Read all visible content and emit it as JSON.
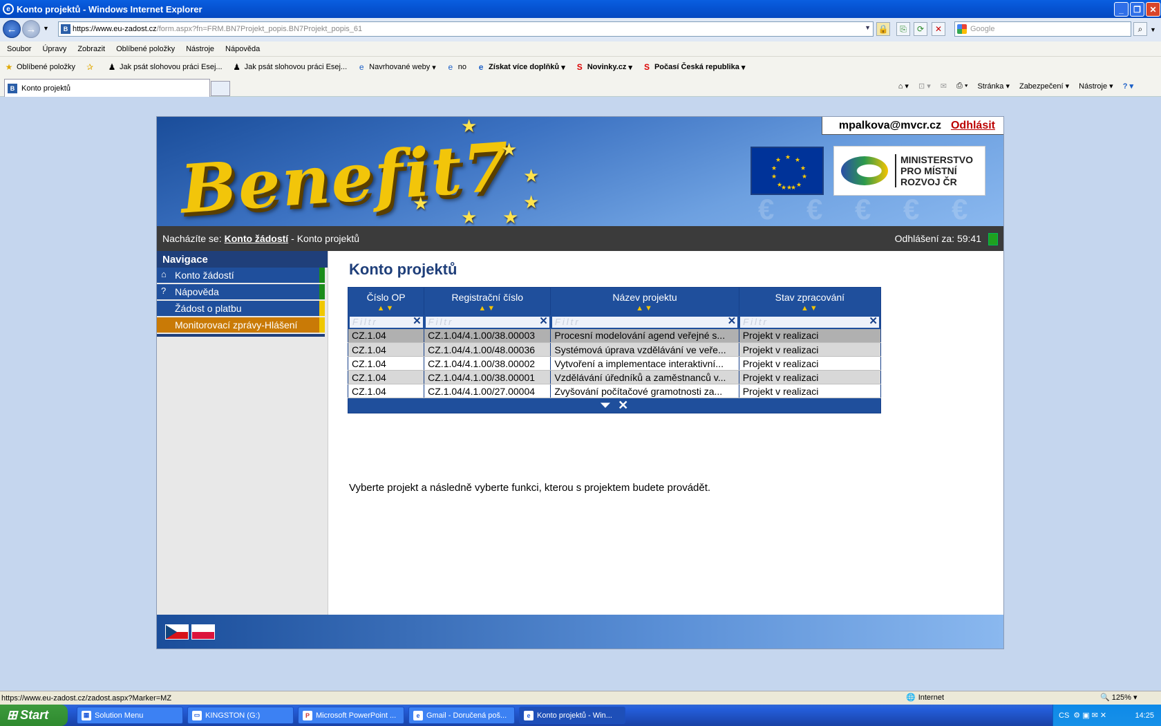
{
  "window": {
    "title": "Konto projektů - Windows Internet Explorer"
  },
  "address": {
    "scheme": "https://",
    "host": "www.eu-zadost.cz",
    "path": "/form.aspx?fn=FRM.BN7Projekt_popis.BN7Projekt_popis_61"
  },
  "search": {
    "placeholder": "Google"
  },
  "menu": [
    "Soubor",
    "Úpravy",
    "Zobrazit",
    "Oblíbené položky",
    "Nástroje",
    "Nápověda"
  ],
  "favorites": {
    "label": "Oblíbené položky",
    "items": [
      "Jak psát slohovou práci Esej...",
      "Jak psát slohovou práci Esej...",
      "Navrhované weby",
      "no",
      "Získat více doplňků",
      "Novinky.cz",
      "Počasí Česká republika"
    ]
  },
  "tab": {
    "title": "Konto projektů"
  },
  "commandbar": {
    "page": "Stránka",
    "security": "Zabezpečení",
    "tools": "Nástroje"
  },
  "header": {
    "user": "mpalkova@mvcr.cz",
    "logout": "Odhlásit",
    "logo_text": "Benefit7",
    "ministry": [
      "MINISTERSTVO",
      "PRO MÍSTNÍ",
      "ROZVOJ ČR"
    ]
  },
  "breadcrumb": {
    "prefix": "Nacházíte se:",
    "link": "Konto žádostí",
    "current": "- Konto projektů",
    "timer_label": "Odhlášení za:",
    "timer": "59:41"
  },
  "navigation": {
    "title": "Navigace",
    "items": [
      {
        "label": "Konto žádostí",
        "icon": "home-icon"
      },
      {
        "label": "Nápověda",
        "icon": "help-icon"
      },
      {
        "label": "Žádost o platbu",
        "icon": ""
      },
      {
        "label": "Monitorovací zprávy-Hlášení",
        "icon": ""
      }
    ]
  },
  "main": {
    "title": "Konto projektů",
    "filter_placeholder": "Filtr",
    "columns": [
      "Číslo OP",
      "Registrační číslo",
      "Název projektu",
      "Stav zpracování"
    ],
    "rows": [
      [
        "CZ.1.04",
        "CZ.1.04/4.1.00/38.00003",
        "Procesní modelování agend veřejné s...",
        "Projekt v realizaci"
      ],
      [
        "CZ.1.04",
        "CZ.1.04/4.1.00/48.00036",
        "Systémová úprava vzdělávání ve veře...",
        "Projekt v realizaci"
      ],
      [
        "CZ.1.04",
        "CZ.1.04/4.1.00/38.00002",
        "Vytvoření a implementace interaktivní...",
        "Projekt v realizaci"
      ],
      [
        "CZ.1.04",
        "CZ.1.04/4.1.00/38.00001",
        "Vzdělávání úředníků a zaměstnanců v...",
        "Projekt v realizaci"
      ],
      [
        "CZ.1.04",
        "CZ.1.04/4.1.00/27.00004",
        "Zvyšování počítačové gramotnosti za...",
        "Projekt v realizaci"
      ]
    ],
    "instruction": "Vyberte projekt a následně vyberte funkci, kterou s projektem budete provádět."
  },
  "statusbar": {
    "url": "https://www.eu-zadost.cz/zadost.aspx?Marker=MZ",
    "zone": "Internet",
    "zoom": "125%"
  },
  "taskbar": {
    "start": "Start",
    "tasks": [
      "Solution Menu",
      "KINGSTON (G:)",
      "Microsoft PowerPoint ...",
      "Gmail - Doručená poš...",
      "Konto projektů - Win..."
    ],
    "lang": "CS",
    "clock": "14:25"
  }
}
